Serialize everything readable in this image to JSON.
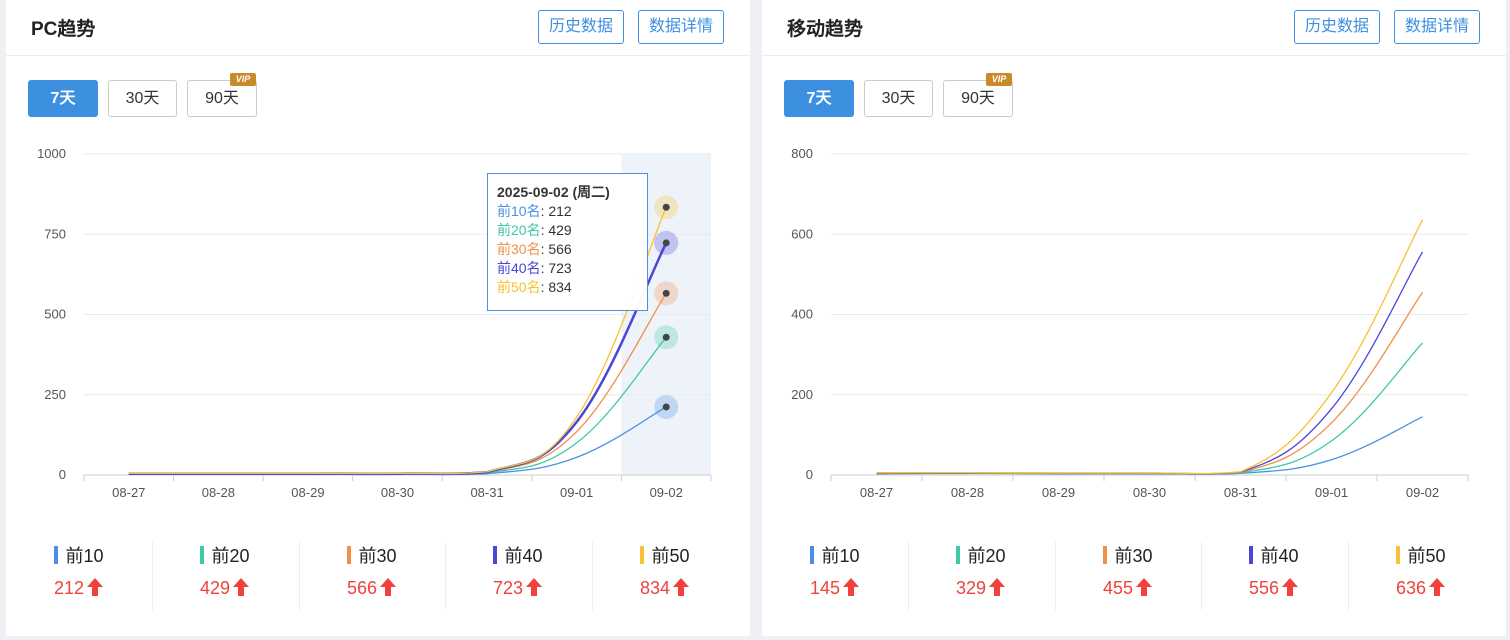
{
  "panels": [
    {
      "title": "PC趋势",
      "buttons": [
        "历史数据",
        "数据详情"
      ],
      "ranges": [
        "7天",
        "30天",
        "90天"
      ],
      "vip_badge": "VIP",
      "tooltip": {
        "date": "2025-09-02 (周二)",
        "rows": [
          {
            "name": "前10名",
            "value": "212"
          },
          {
            "name": "前20名",
            "value": "429"
          },
          {
            "name": "前30名",
            "value": "566"
          },
          {
            "name": "前40名",
            "value": "723"
          },
          {
            "name": "前50名",
            "value": "834"
          }
        ]
      },
      "stats": [
        {
          "label": "前10",
          "value": "212"
        },
        {
          "label": "前20",
          "value": "429"
        },
        {
          "label": "前30",
          "value": "566"
        },
        {
          "label": "前40",
          "value": "723"
        },
        {
          "label": "前50",
          "value": "834"
        }
      ]
    },
    {
      "title": "移动趋势",
      "buttons": [
        "历史数据",
        "数据详情"
      ],
      "ranges": [
        "7天",
        "30天",
        "90天"
      ],
      "vip_badge": "VIP",
      "stats": [
        {
          "label": "前10",
          "value": "145"
        },
        {
          "label": "前20",
          "value": "329"
        },
        {
          "label": "前30",
          "value": "455"
        },
        {
          "label": "前40",
          "value": "556"
        },
        {
          "label": "前50",
          "value": "636"
        }
      ]
    }
  ],
  "colors": {
    "accent": "#3d8fe0",
    "up": "#f0413c",
    "series": [
      "#4a8fe6",
      "#3ec9a7",
      "#f0904c",
      "#4a46d8",
      "#f6c232"
    ]
  },
  "chart_data": [
    {
      "type": "line",
      "categories": [
        "08-27",
        "08-28",
        "08-29",
        "08-30",
        "08-31",
        "09-01",
        "09-02"
      ],
      "ylim": [
        0,
        1000
      ],
      "yticks": [
        0,
        250,
        500,
        750,
        1000
      ],
      "grid": true,
      "highlight_category": "09-02",
      "series": [
        {
          "name": "前10名",
          "values": [
            3,
            3,
            3,
            3,
            4,
            55,
            212
          ]
        },
        {
          "name": "前20名",
          "values": [
            4,
            4,
            4,
            4,
            6,
            100,
            429
          ]
        },
        {
          "name": "前30名",
          "values": [
            4,
            4,
            4,
            4,
            8,
            135,
            566
          ]
        },
        {
          "name": "前40名",
          "values": [
            4,
            4,
            4,
            4,
            9,
            165,
            723
          ]
        },
        {
          "name": "前50名",
          "values": [
            5,
            5,
            5,
            5,
            10,
            180,
            834
          ]
        }
      ]
    },
    {
      "type": "line",
      "categories": [
        "08-27",
        "08-28",
        "08-29",
        "08-30",
        "08-31",
        "09-01",
        "09-02"
      ],
      "ylim": [
        0,
        800
      ],
      "yticks": [
        0,
        200,
        400,
        600,
        800
      ],
      "grid": true,
      "series": [
        {
          "name": "前10",
          "values": [
            3,
            4,
            3,
            3,
            4,
            38,
            145
          ]
        },
        {
          "name": "前20",
          "values": [
            4,
            4,
            4,
            4,
            5,
            85,
            329
          ]
        },
        {
          "name": "前30",
          "values": [
            4,
            5,
            4,
            4,
            6,
            130,
            455
          ]
        },
        {
          "name": "前40",
          "values": [
            5,
            5,
            5,
            5,
            7,
            165,
            556
          ]
        },
        {
          "name": "前50",
          "values": [
            6,
            6,
            5,
            5,
            8,
            205,
            636
          ]
        }
      ]
    }
  ]
}
